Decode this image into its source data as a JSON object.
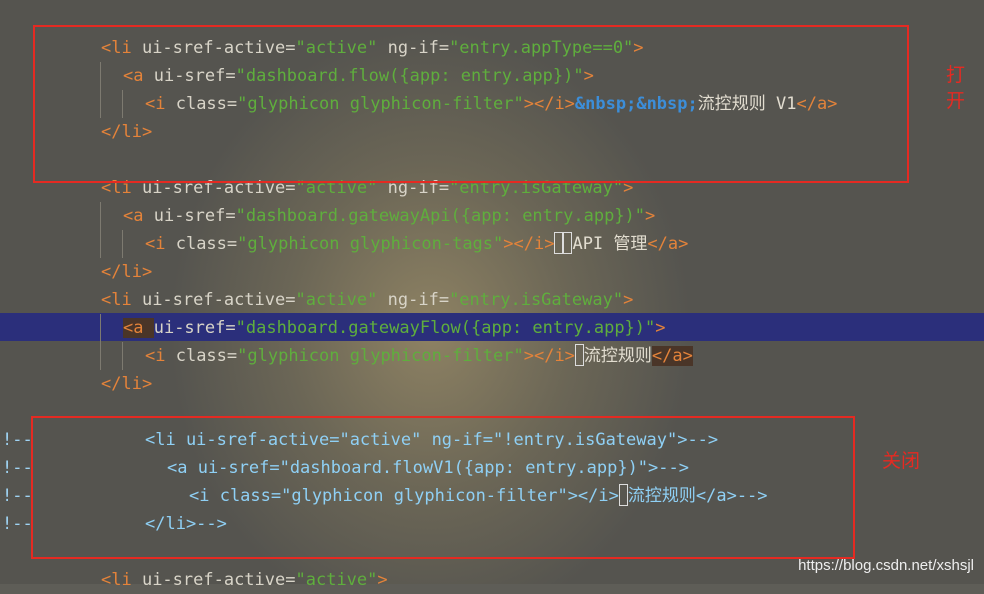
{
  "annotations": {
    "open_label": "打开",
    "close_label": "关闭"
  },
  "watermark": "https://blog.csdn.net/xshsjl",
  "code": {
    "l1": {
      "open": "<li ",
      "a1": "ui-sref-active",
      "eq": "=",
      "v1": "\"active\"",
      "a2": " ng-if",
      "v2": "\"entry.appType==0\"",
      "close": ">"
    },
    "l2": {
      "open": "<a ",
      "a1": "ui-sref",
      "v1": "\"dashboard.flow({app: entry.app})\"",
      "close": ">"
    },
    "l3": {
      "open": "<i ",
      "a1": "class",
      "v1": "\"glyphicon glyphicon-filter\"",
      "close": "></i>",
      "ent": "&nbsp;&nbsp;",
      "text": "流控规则 V1",
      "end": "</a>"
    },
    "l4": {
      "end": "</li>"
    },
    "l5": {
      "open": "<li ",
      "a1": "ui-sref-active",
      "v1": "\"active\"",
      "a2": " ng-if",
      "v2": "\"entry.isGateway\"",
      "close": ">"
    },
    "l6": {
      "open": "<a ",
      "a1": "ui-sref",
      "v1": "\"dashboard.gatewayApi({app: entry.app})\"",
      "close": ">"
    },
    "l7": {
      "open": "<i ",
      "a1": "class",
      "v1": "\"glyphicon glyphicon-tags\"",
      "close": "></i>",
      "text": "API 管理",
      "end": "</a>"
    },
    "l8": {
      "end": "</li>"
    },
    "l9": {
      "open": "<li ",
      "a1": "ui-sref-active",
      "v1": "\"active\"",
      "a2": " ng-if",
      "v2": "\"entry.isGateway\"",
      "close": ">"
    },
    "l10": {
      "open": "<a ",
      "a1": "ui-sref",
      "v1": "\"dashboard.gatewayFlow({app: entry.app})\"",
      "close": ">"
    },
    "l11": {
      "open": "<i ",
      "a1": "class",
      "v1": "\"glyphicon glyphicon-filter\"",
      "close": "></i>",
      "text": "流控规则",
      "end": "</a>"
    },
    "l12": {
      "end": "</li>"
    },
    "l13": {
      "prefix": "!--",
      "text": "<li ui-sref-active=\"active\" ng-if=\"!entry.isGateway\">-->"
    },
    "l14": {
      "prefix": "!--",
      "text": "<a ui-sref=\"dashboard.flowV1({app: entry.app})\">-->"
    },
    "l15": {
      "prefix": "!--",
      "t1": "<i class=\"glyphicon glyphicon-filter\"></i>",
      "t2": "流控规则</a>-->"
    },
    "l16": {
      "prefix": "!--",
      "text": "</li>-->"
    },
    "l17": {
      "open": "<li ",
      "a1": "ui-sref-active",
      "v1": "\"active\"",
      "close": ">"
    }
  }
}
